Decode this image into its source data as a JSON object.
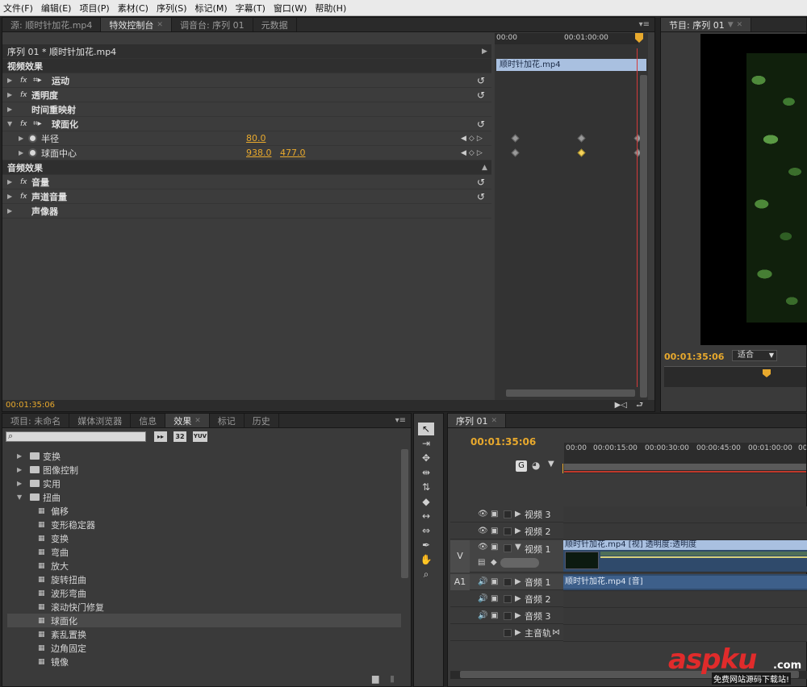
{
  "menu": [
    "文件(F)",
    "编辑(E)",
    "项目(P)",
    "素材(C)",
    "序列(S)",
    "标记(M)",
    "字幕(T)",
    "窗口(W)",
    "帮助(H)"
  ],
  "source_panel": {
    "tabs": [
      "源: 顺时针加花.mp4",
      "特效控制台",
      "调音台: 序列 01",
      "元数据"
    ],
    "active_tab": 1
  },
  "effect_controls": {
    "header": "序列 01 * 顺时针加花.mp4",
    "ruler_times": [
      "00:00",
      "00:01:00:00"
    ],
    "clip_name": "顺时针加花.mp4",
    "video_section": "视频效果",
    "audio_section": "音频效果",
    "effects": [
      {
        "label": "运动",
        "fx": true,
        "motion_icon": true,
        "reset": true
      },
      {
        "label": "透明度",
        "fx": true,
        "motion_icon": false,
        "reset": true
      },
      {
        "label": "时间重映射",
        "fx": false,
        "motion_icon": false,
        "reset": false
      },
      {
        "label": "球面化",
        "fx": true,
        "motion_icon": true,
        "reset": true,
        "expanded": true
      }
    ],
    "params": [
      {
        "label": "半径",
        "value1": "80.0",
        "value2": ""
      },
      {
        "label": "球面中心",
        "value1": "938.0",
        "value2": "477.0"
      }
    ],
    "audio_effects": [
      {
        "label": "音量",
        "reset": true
      },
      {
        "label": "声道音量",
        "reset": true
      },
      {
        "label": "声像器",
        "reset": false
      }
    ],
    "current_time": "00:01:35:06"
  },
  "program_monitor": {
    "tab": "节目: 序列 01",
    "timecode": "00:01:35:06",
    "zoom": "适合"
  },
  "project_panel": {
    "tabs": [
      "项目: 未命名",
      "媒体浏览器",
      "信息",
      "效果",
      "标记",
      "历史"
    ],
    "active_tab": 3,
    "badges": [
      "32",
      "YUV"
    ],
    "tree": [
      {
        "label": "变换",
        "type": "folder",
        "expanded": false
      },
      {
        "label": "图像控制",
        "type": "folder",
        "expanded": false
      },
      {
        "label": "实用",
        "type": "folder",
        "expanded": false
      },
      {
        "label": "扭曲",
        "type": "folder",
        "expanded": true
      },
      {
        "label": "偏移",
        "type": "effect"
      },
      {
        "label": "变形稳定器",
        "type": "effect"
      },
      {
        "label": "变换",
        "type": "effect"
      },
      {
        "label": "弯曲",
        "type": "effect"
      },
      {
        "label": "放大",
        "type": "effect"
      },
      {
        "label": "旋转扭曲",
        "type": "effect"
      },
      {
        "label": "波形弯曲",
        "type": "effect"
      },
      {
        "label": "滚动快门修复",
        "type": "effect"
      },
      {
        "label": "球面化",
        "type": "effect",
        "selected": true
      },
      {
        "label": "紊乱置换",
        "type": "effect"
      },
      {
        "label": "边角固定",
        "type": "effect"
      },
      {
        "label": "镜像",
        "type": "effect"
      }
    ]
  },
  "timeline": {
    "tab": "序列 01",
    "timecode": "00:01:35:06",
    "ruler": [
      "00:00",
      "00:00:15:00",
      "00:00:30:00",
      "00:00:45:00",
      "00:01:00:00",
      "00"
    ],
    "video_tracks": [
      "视频 3",
      "视频 2",
      "视频 1"
    ],
    "audio_tracks": [
      "音频 1",
      "音频 2",
      "音频 3"
    ],
    "master_track": "主音轨",
    "v_label": "V",
    "a_label": "A1",
    "video_clip": "顺时针加花.mp4 [视] 透明度:透明度",
    "audio_clip": "顺时针加花.mp4 [音]"
  },
  "watermark": {
    "main": "aspku",
    "suffix": ".com",
    "sub": "免费网站源码下载站!"
  }
}
